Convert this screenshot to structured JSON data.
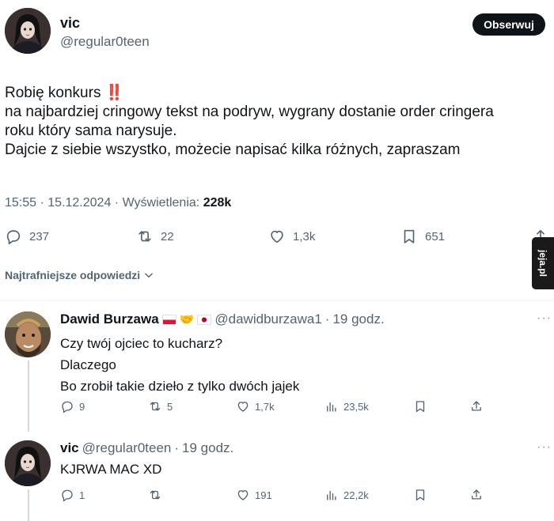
{
  "main_tweet": {
    "display_name": "vic",
    "handle": "@regular0teen",
    "follow_label": "Obserwuj",
    "text_line1": "Robię konkurs",
    "text_emoji": "‼️",
    "text_line2": "na najbardziej cringowy tekst na podryw, wygrany dostanie order cringera",
    "text_line3": "roku który sama narysuje.",
    "text_line4": "Dajcie z siebie wszystko, możecie napisać kilka różnych, zapraszam",
    "time": "15:55",
    "date": "15.12.2024",
    "views_label": "Wyświetlenia:",
    "views_value": "228k",
    "replies": "237",
    "reposts": "22",
    "likes": "1,3k",
    "bookmarks": "651"
  },
  "sort_label": "Najtrafniejsze odpowiedzi",
  "watermark": "jeja.pl",
  "replies": [
    {
      "display_name": "Dawid Burzawa",
      "handle": "@dawidburzawa1",
      "time": "19 godz.",
      "lines": [
        "Czy twój ojciec to kucharz?",
        "Dlaczego",
        "Bo zrobił takie dzieło z tylko dwóch jajek"
      ],
      "replies": "9",
      "reposts": "5",
      "likes": "1,7k",
      "views": "23,5k"
    },
    {
      "display_name": "vic",
      "handle": "@regular0teen",
      "time": "19 godz.",
      "lines": [
        "KJRWA MAC XD"
      ],
      "replies": "1",
      "reposts": "",
      "likes": "191",
      "views": "22,2k"
    }
  ],
  "colors": {
    "text": "#0f1419",
    "muted": "#536471",
    "divider": "#eff3f4",
    "alert": "#e0245e"
  }
}
